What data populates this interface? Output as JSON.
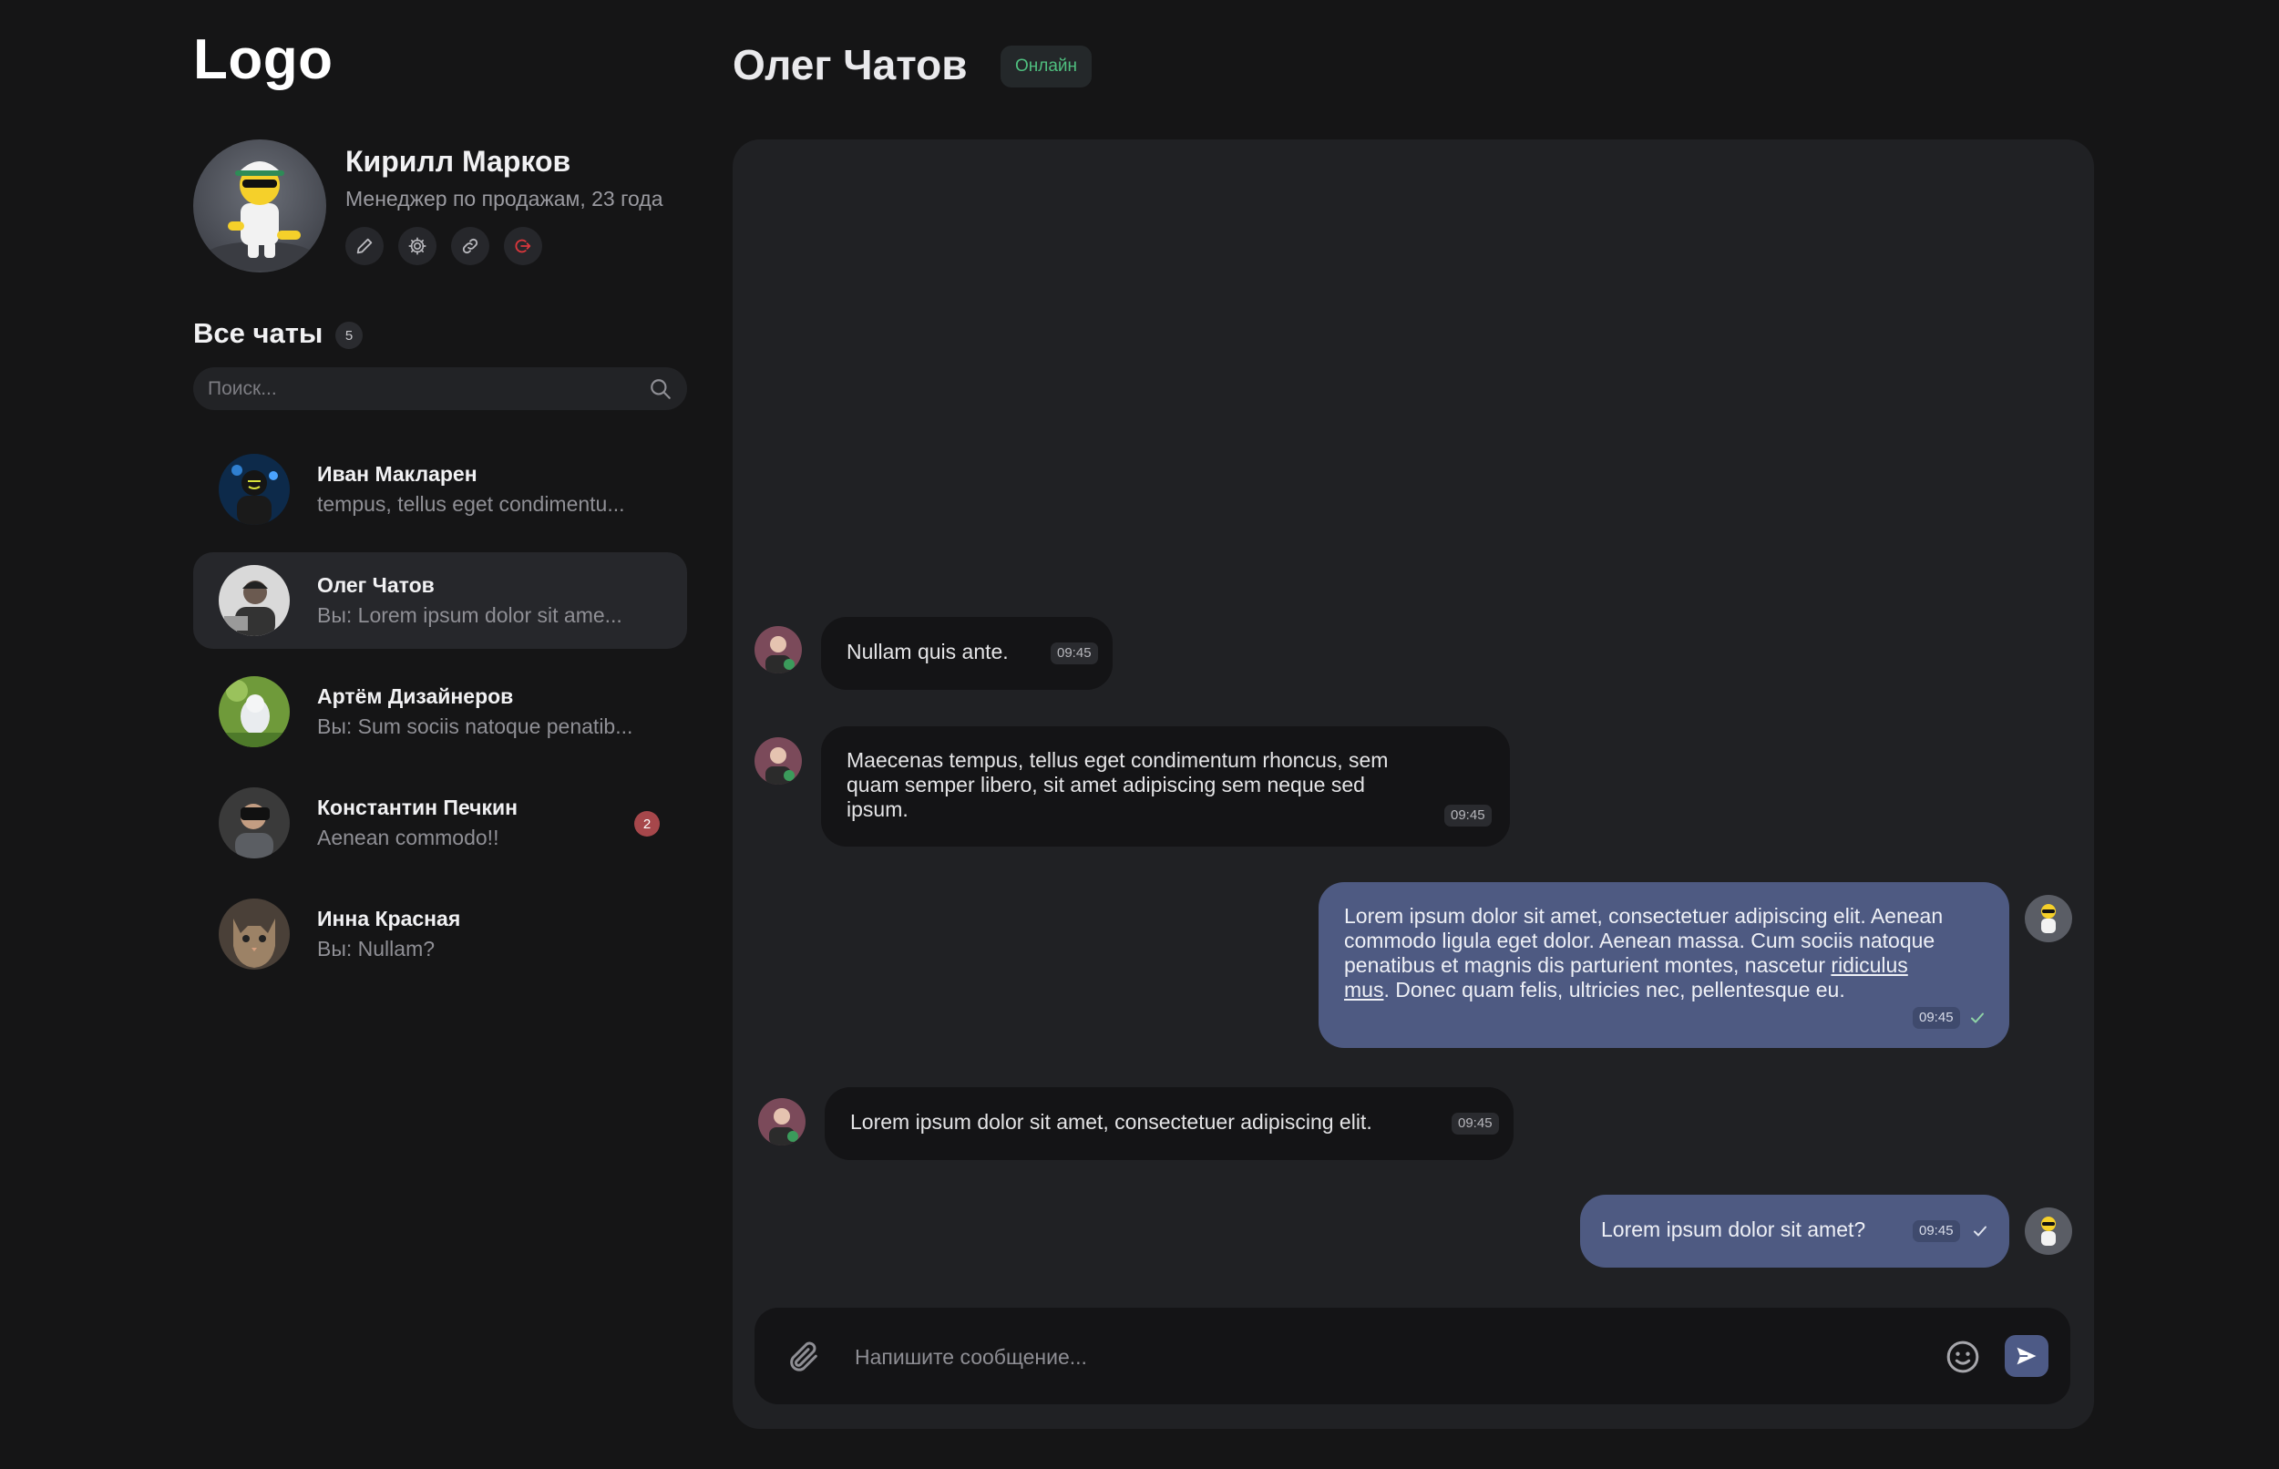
{
  "app": {
    "logo": "Logo"
  },
  "profile": {
    "name": "Кирилл Марков",
    "role": "Менеджер по продажам, 23 года",
    "actions": [
      "edit-icon",
      "settings-icon",
      "link-icon",
      "logout-icon"
    ]
  },
  "chats": {
    "title": "Все чаты",
    "count": "5",
    "search_placeholder": "Поиск...",
    "items": [
      {
        "name": "Иван Макларен",
        "preview": "tempus, tellus eget condimentu...",
        "active": false,
        "unread": ""
      },
      {
        "name": "Олег Чатов",
        "preview": "Вы: Lorem ipsum dolor sit ame...",
        "active": true,
        "unread": ""
      },
      {
        "name": "Артём Дизайнеров",
        "preview": "Вы: Sum sociis natoque penatib...",
        "active": false,
        "unread": ""
      },
      {
        "name": "Константин Печкин",
        "preview": "Aenean commodo!!",
        "active": false,
        "unread": "2"
      },
      {
        "name": "Инна Красная",
        "preview": "Вы: Nullam?",
        "active": false,
        "unread": ""
      }
    ]
  },
  "conversation": {
    "contact": "Олег Чатов",
    "status": "Онлайн",
    "messages": [
      {
        "dir": "in",
        "text": "Nullam quis ante.",
        "time": "09:45"
      },
      {
        "dir": "in",
        "text": "Maecenas tempus, tellus eget condimentum rhoncus, sem quam semper libero, sit amet adipiscing sem neque sed ipsum.",
        "time": "09:45"
      },
      {
        "dir": "out",
        "text_before": "Lorem ipsum dolor sit amet, consectetuer adipiscing elit. Aenean commodo ligula eget dolor. Aenean massa. Cum sociis natoque penatibus et magnis dis parturient montes, nascetur ",
        "link": "ridiculus mus",
        "text_after": ". Donec quam felis, ultricies nec, pellentesque eu.",
        "time": "09:45",
        "read": true
      },
      {
        "dir": "in",
        "text": "Lorem ipsum dolor sit amet, consectetuer adipiscing elit.",
        "time": "09:45"
      },
      {
        "dir": "out",
        "text": "Lorem ipsum dolor sit amet?",
        "time": "09:45",
        "read": true
      }
    ],
    "composer_placeholder": "Напишите сообщение..."
  },
  "colors": {
    "background": "#151516",
    "panel": "#202124",
    "incoming_bubble": "#141416",
    "outgoing_bubble": "#4e5a82",
    "online": "#4fbf7f",
    "unread_badge": "#a6474b",
    "logout": "#d9373c"
  }
}
